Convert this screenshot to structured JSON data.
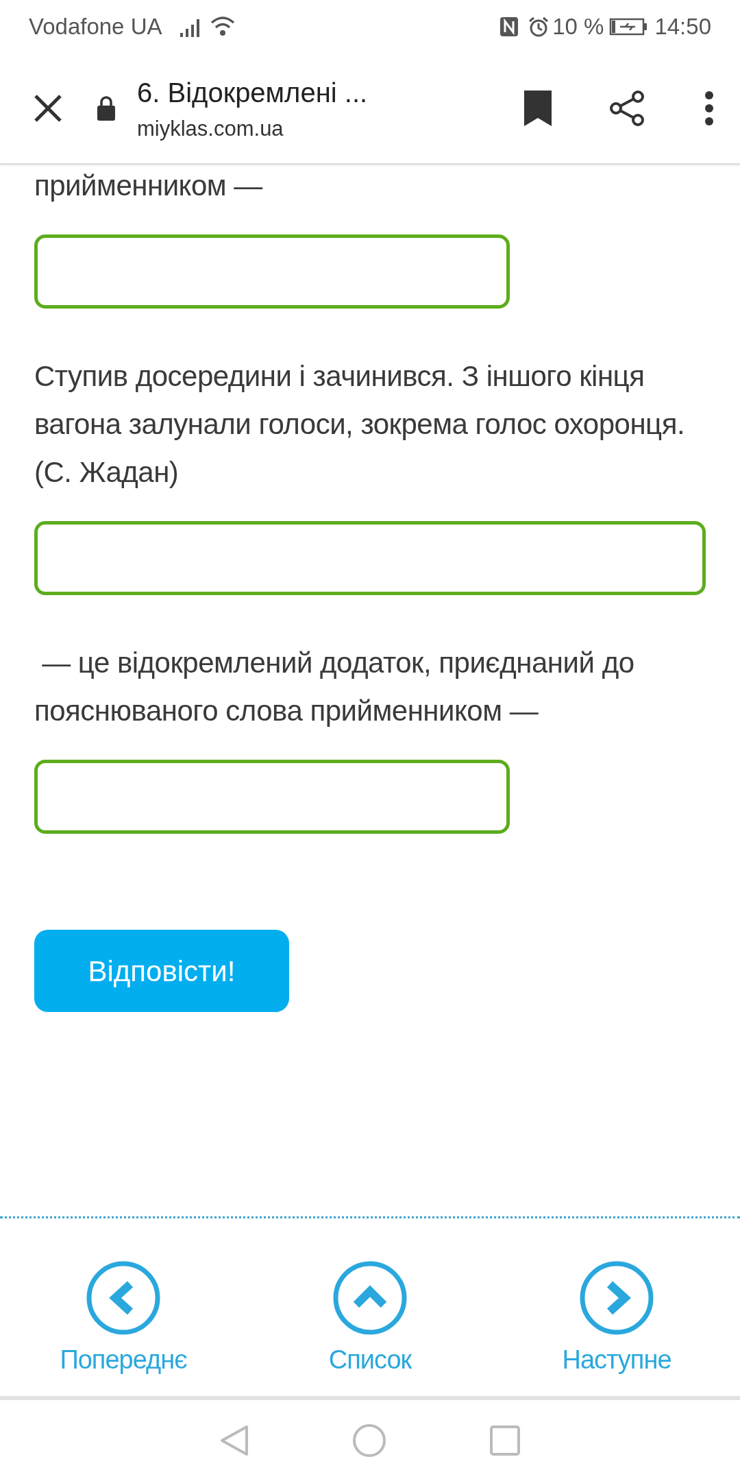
{
  "status_bar": {
    "carrier": "Vodafone UA",
    "battery": "10 %",
    "time": "14:50"
  },
  "browser_bar": {
    "title": "6. Відокремлені ...",
    "url": "miyklas.com.ua"
  },
  "content": [
    {
      "kind": "text",
      "text": "прийменником —"
    },
    {
      "kind": "field",
      "wide": false
    },
    {
      "kind": "text",
      "text": "Ступив досередини і зачинився. З іншого кінця вагона залунали голоси, зокрема голос охоронця. (С. Жадан)"
    },
    {
      "kind": "field",
      "wide": true
    },
    {
      "kind": "text",
      "text": " — це відокремлений додаток, приєднаний до пояснюваного слова прийменником —"
    },
    {
      "kind": "field",
      "wide": false
    }
  ],
  "submit_button": "Відповісти!",
  "nav": [
    {
      "kind": "previous",
      "label": "Попереднє"
    },
    {
      "kind": "list",
      "label": "Список"
    },
    {
      "kind": "next",
      "label": "Наступне"
    }
  ]
}
